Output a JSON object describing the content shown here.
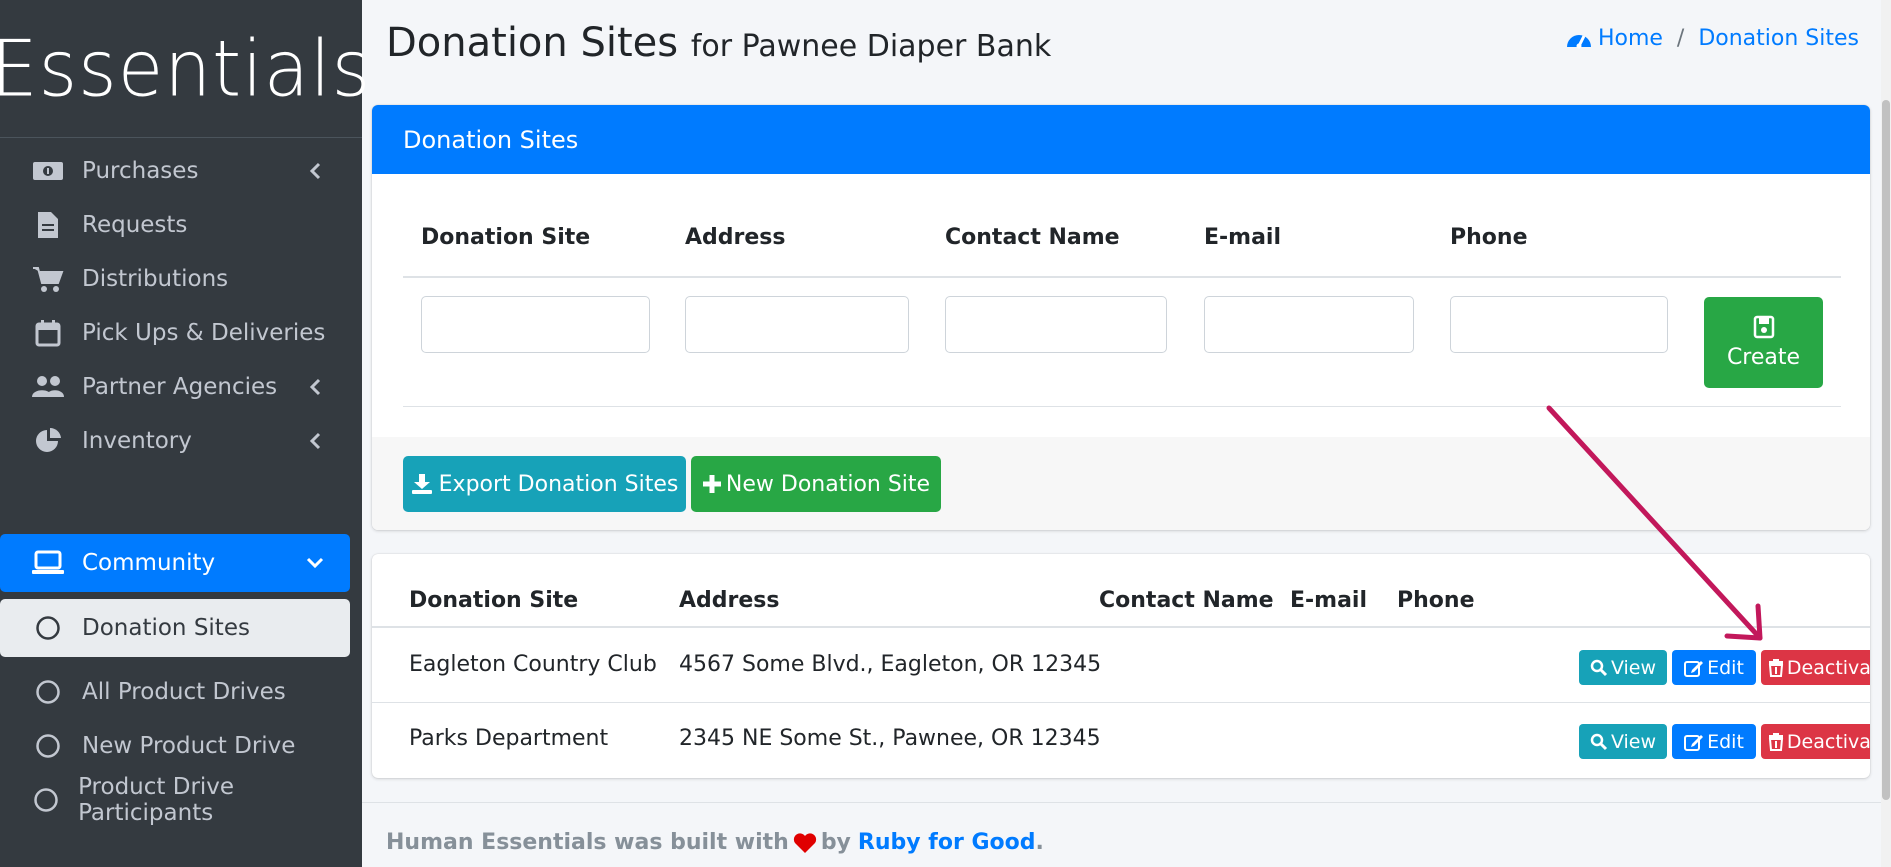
{
  "brand": {
    "name": "Essentials"
  },
  "sidebar": {
    "items": [
      {
        "label": "Purchases",
        "icon": "money-bill-icon",
        "has_chevron": true
      },
      {
        "label": "Requests",
        "icon": "file-icon",
        "has_chevron": false
      },
      {
        "label": "Distributions",
        "icon": "shopping-cart-icon",
        "has_chevron": false
      },
      {
        "label": "Pick Ups & Deliveries",
        "icon": "calendar-icon",
        "has_chevron": false
      },
      {
        "label": "Partner Agencies",
        "icon": "users-icon",
        "has_chevron": true
      },
      {
        "label": "Inventory",
        "icon": "pie-chart-icon",
        "has_chevron": true
      },
      {
        "label": "Community",
        "icon": "laptop-icon",
        "has_chevron": true,
        "active": true
      },
      {
        "label": "Donation Sites",
        "icon": "circle-icon",
        "sub": true,
        "current": true
      },
      {
        "label": "All Product Drives",
        "icon": "circle-icon",
        "sub": true
      },
      {
        "label": "New Product Drive",
        "icon": "circle-icon",
        "sub": true
      },
      {
        "label": "Product Drive Participants",
        "icon": "circle-icon",
        "sub": true
      }
    ]
  },
  "header": {
    "title": "Donation Sites",
    "subtitle": "for Pawnee Diaper Bank",
    "breadcrumb": {
      "home": "Home",
      "separator": "/",
      "current": "Donation Sites"
    }
  },
  "filter_card": {
    "title": "Donation Sites",
    "columns": [
      "Donation Site",
      "Address",
      "Contact Name",
      "E-mail",
      "Phone"
    ],
    "inputs": [
      "",
      "",
      "",
      "",
      ""
    ],
    "create_label": "Create",
    "export_label": "Export Donation Sites",
    "new_label": "New Donation Site"
  },
  "table": {
    "columns": [
      "Donation Site",
      "Address",
      "Contact Name",
      "E-mail",
      "Phone"
    ],
    "rows": [
      {
        "name": "Eagleton Country Club",
        "address": "4567 Some Blvd., Eagleton, OR 12345",
        "contact": "",
        "email": "",
        "phone": ""
      },
      {
        "name": "Parks Department",
        "address": "2345 NE Some St., Pawnee, OR 12345",
        "contact": "",
        "email": "",
        "phone": ""
      }
    ],
    "actions": {
      "view": "View",
      "edit": "Edit",
      "deactivate": "Deactivate"
    }
  },
  "footer": {
    "text1": "Human Essentials was built with",
    "text2": "by",
    "link": "Ruby for Good",
    "end": "."
  },
  "colors": {
    "primary": "#007bff",
    "success": "#28a745",
    "info": "#17a2b8",
    "danger": "#dc3545",
    "sidebar": "#343a40",
    "annotation": "#c2185b"
  }
}
